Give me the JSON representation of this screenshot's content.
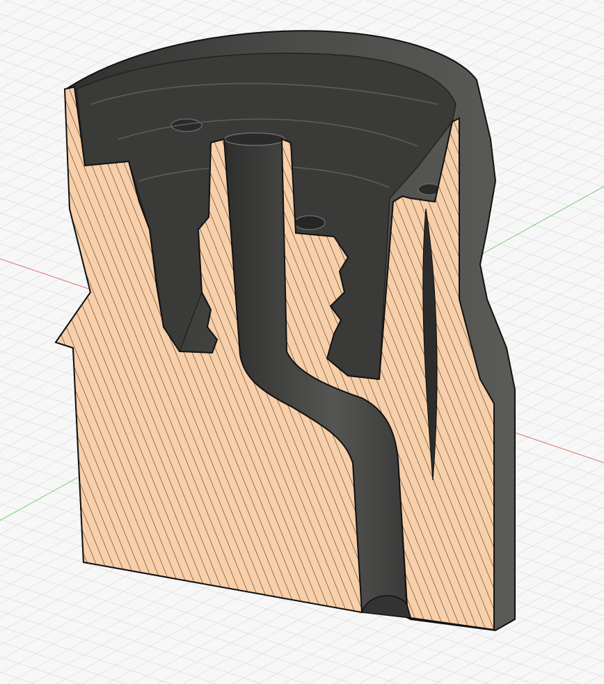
{
  "viewport": {
    "view": "section-analysis",
    "colors": {
      "background": "#f7f7f7",
      "grid": "#dcdcdc",
      "x_axis": "#e07070",
      "y_axis": "#7fcf7f",
      "body": "#3d3d3b",
      "section_face": "#f8cfa8",
      "hatch": "#2a2a2a"
    }
  }
}
